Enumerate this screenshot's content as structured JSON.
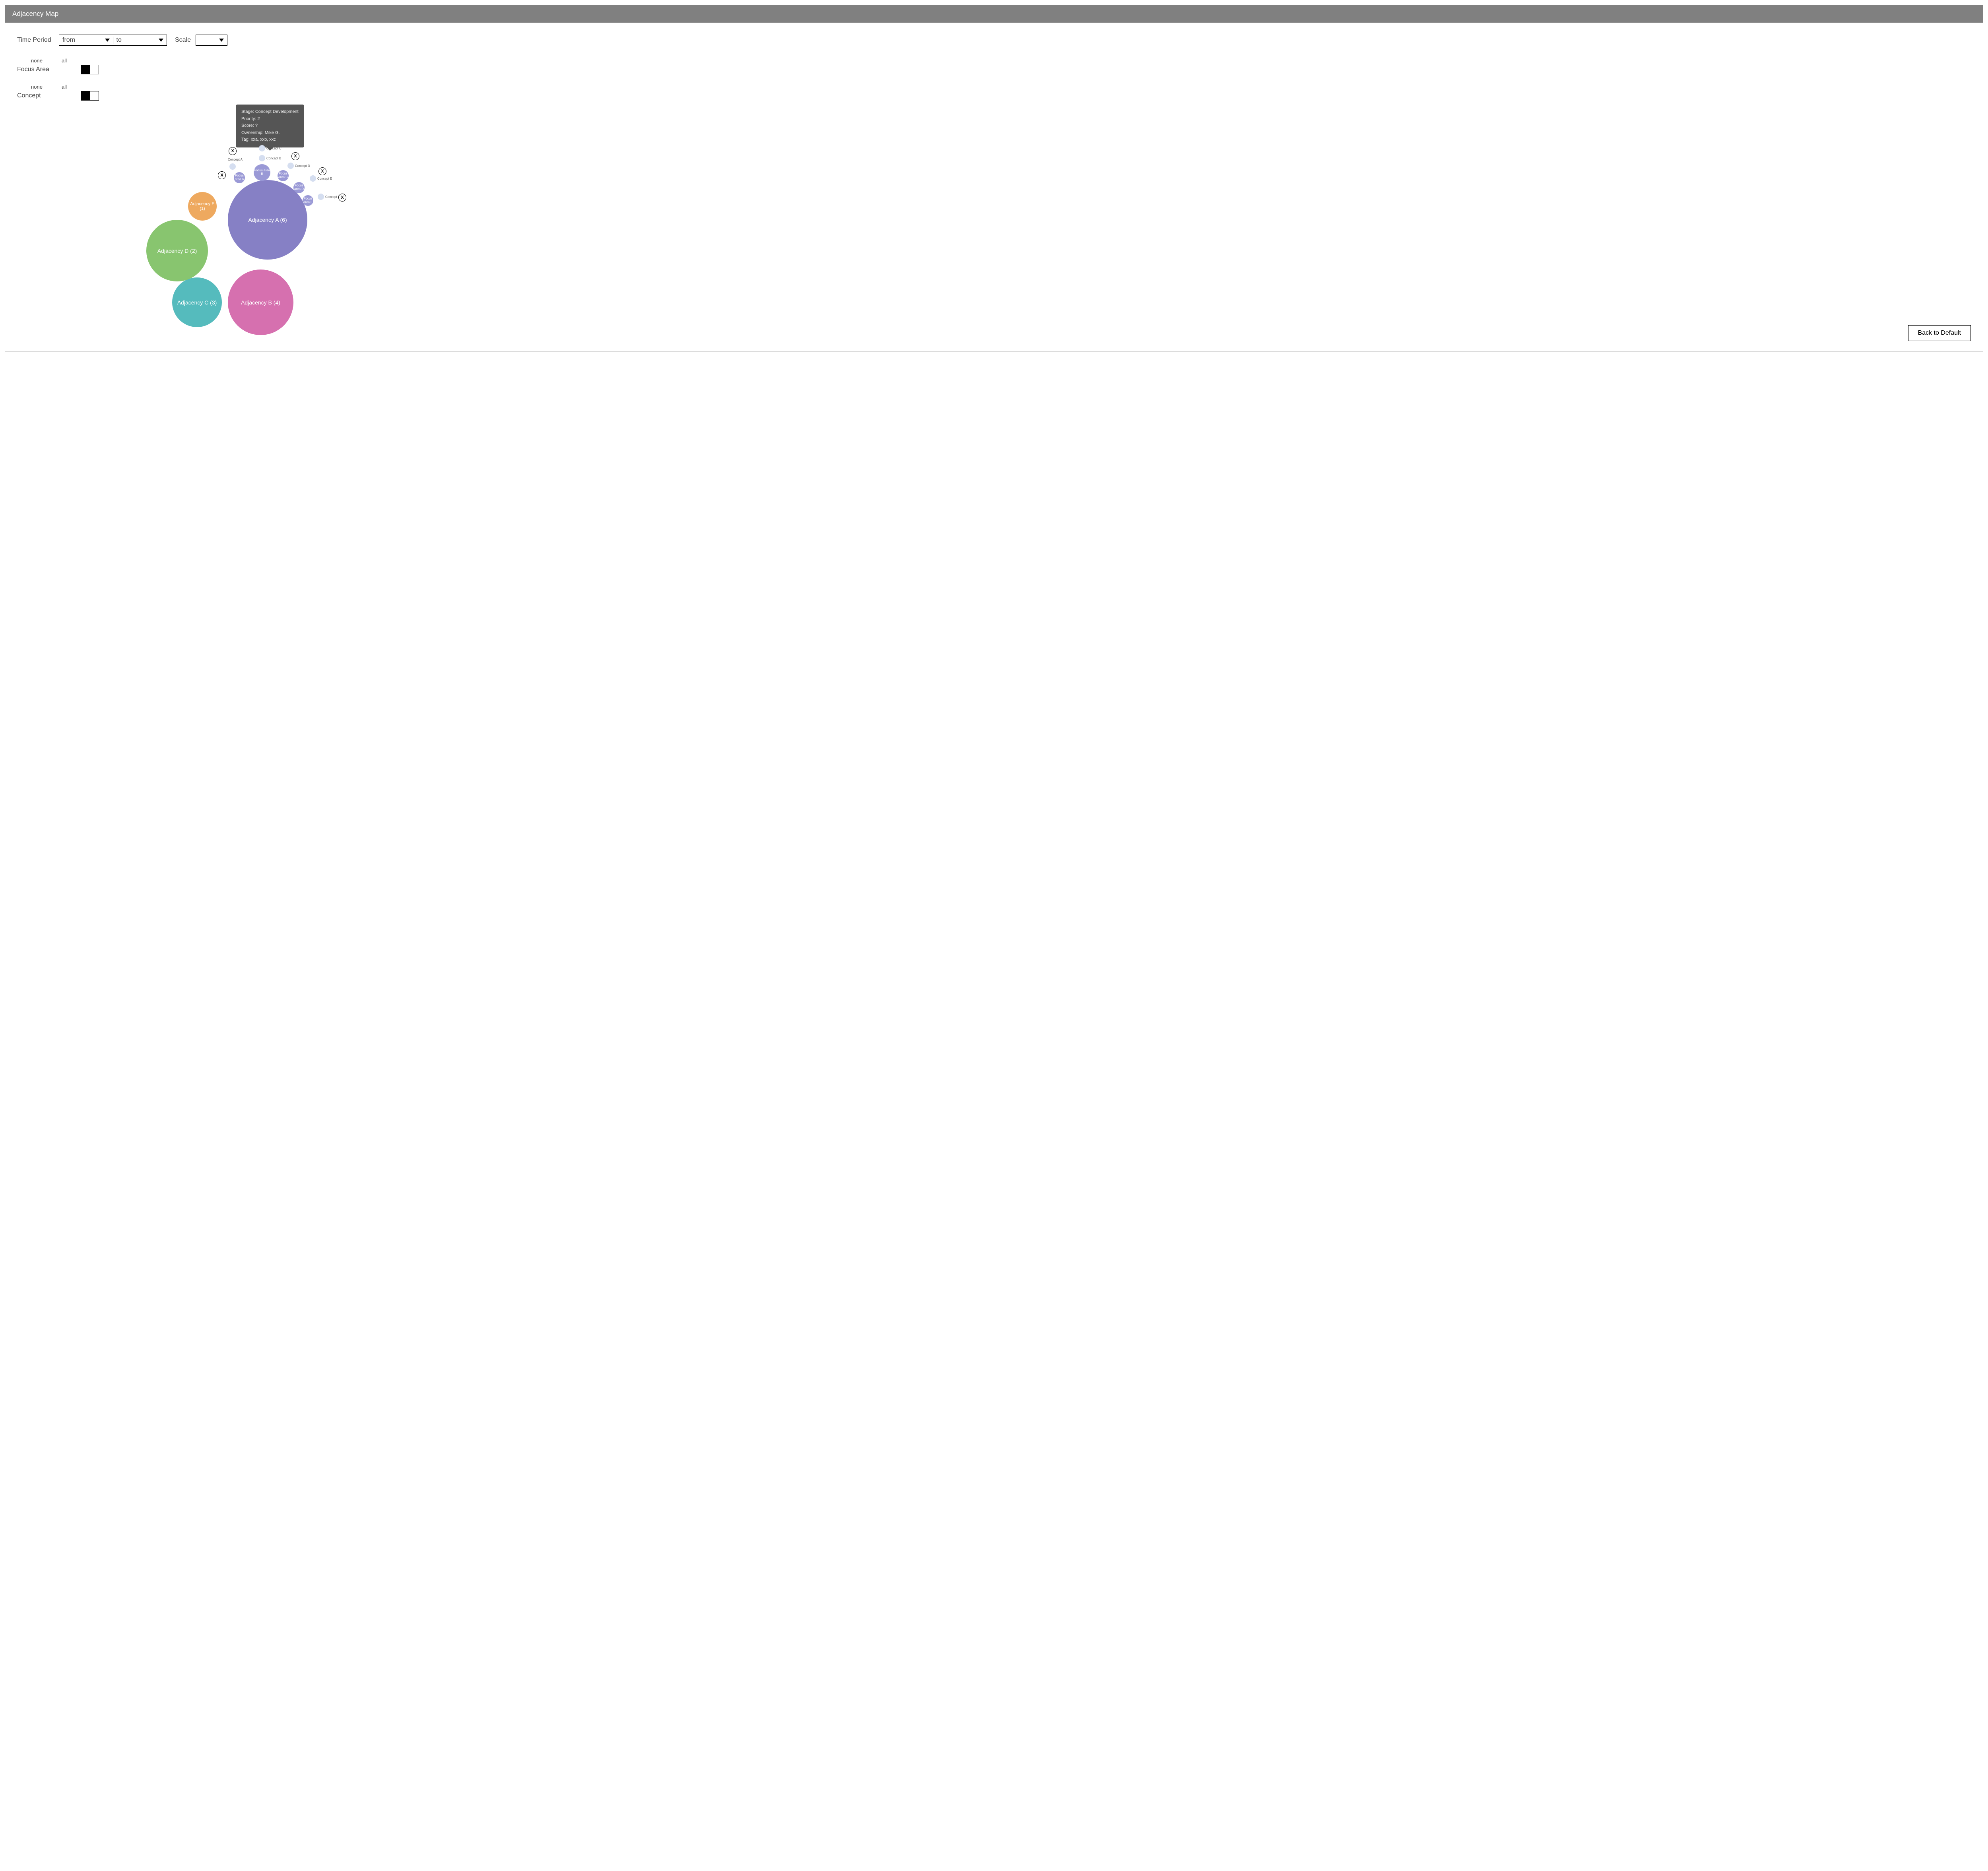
{
  "title": "Adjacency Map",
  "controls": {
    "time_period_label": "Time Period",
    "from_label": "from",
    "to_label": "to",
    "scale_label": "Scale",
    "focus_area_label": "Focus Area",
    "concept_label": "Concept",
    "toggle_none": "none",
    "toggle_all": "all"
  },
  "tooltip": {
    "stage": "Stage: Concept Development",
    "priority": "Priority: 2",
    "score": "Score: ?",
    "ownership": "Ownership: Mike G.",
    "tag": "Tag: xxa, xxb, xxc"
  },
  "bubbles": {
    "adj_a": "Adjacency A (6)",
    "adj_b": "Adjacency B (4)",
    "adj_c": "Adjacency C (3)",
    "adj_d": "Adjacency D (2)",
    "adj_e": "Adjacency E (1)",
    "focus_a": "Focus area A",
    "focus_b": "Focus area B",
    "focus_c": "Focus area C",
    "focus_d": "Focus area D",
    "focus_f": "Focus area F",
    "concept_a": "Concept A",
    "concept_b": "Concept B",
    "concept_c": "Concept C",
    "concept_d": "Concept D",
    "concept_e": "Concept E",
    "concept_f": "Concept F"
  },
  "colors": {
    "adj_a": "#8680c5",
    "adj_b": "#d670af",
    "adj_c": "#55bbbd",
    "adj_d": "#88c56f",
    "adj_e": "#eea95f",
    "focus": "#9a99d6",
    "concept": "#d5def0"
  },
  "back_button": "Back to Default",
  "chart_data": {
    "type": "bubble-cluster",
    "title": "Adjacency Map",
    "adjacencies": [
      {
        "name": "Adjacency A",
        "count": 6,
        "color": "#8680c5"
      },
      {
        "name": "Adjacency B",
        "count": 4,
        "color": "#d670af"
      },
      {
        "name": "Adjacency C",
        "count": 3,
        "color": "#55bbbd"
      },
      {
        "name": "Adjacency D",
        "count": 2,
        "color": "#88c56f"
      },
      {
        "name": "Adjacency E",
        "count": 1,
        "color": "#eea95f"
      }
    ],
    "focus_areas": [
      {
        "name": "Focus area A",
        "parent": "Adjacency A"
      },
      {
        "name": "Focus area B",
        "parent": "Adjacency A"
      },
      {
        "name": "Focus area C",
        "parent": "Adjacency A"
      },
      {
        "name": "Focus area D",
        "parent": "Adjacency A"
      },
      {
        "name": "Focus area F",
        "parent": "Adjacency A"
      }
    ],
    "concepts": [
      {
        "name": "Concept A",
        "parent": "Focus area A"
      },
      {
        "name": "Concept B",
        "parent": "Focus area B"
      },
      {
        "name": "Concept C",
        "parent": "Focus area B",
        "tooltip": {
          "Stage": "Concept Development",
          "Priority": 2,
          "Score": "?",
          "Ownership": "Mike G.",
          "Tag": "xxa, xxb, xxc"
        }
      },
      {
        "name": "Concept D",
        "parent": "Focus area C"
      },
      {
        "name": "Concept E",
        "parent": "Focus area D"
      },
      {
        "name": "Concept F",
        "parent": "Focus area F"
      }
    ]
  }
}
